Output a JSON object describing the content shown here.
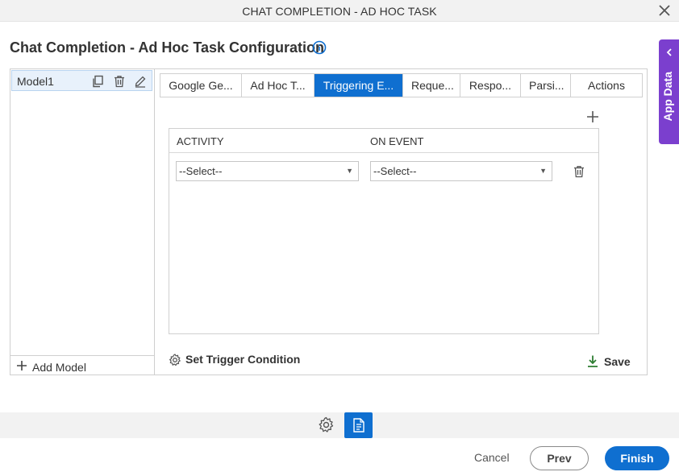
{
  "window": {
    "title": "CHAT COMPLETION - AD HOC TASK"
  },
  "page": {
    "title": "Chat Completion - Ad Hoc Task Configuration"
  },
  "side_panel": {
    "label": "App Data"
  },
  "models": {
    "items": [
      {
        "name": "Model1"
      }
    ],
    "add_label": "Add Model"
  },
  "tabs": [
    {
      "label": "Google Ge...",
      "active": false
    },
    {
      "label": "Ad Hoc T...",
      "active": false
    },
    {
      "label": "Triggering E...",
      "active": true
    },
    {
      "label": "Reque...",
      "active": false
    },
    {
      "label": "Respo...",
      "active": false
    },
    {
      "label": "Parsi...",
      "active": false
    },
    {
      "label": "Actions",
      "active": false
    }
  ],
  "grid": {
    "columns": [
      "ACTIVITY",
      "ON EVENT"
    ],
    "rows": [
      {
        "activity": "--Select--",
        "on_event": "--Select--"
      }
    ]
  },
  "actions": {
    "trigger_label": "Set Trigger Condition",
    "save_label": "Save"
  },
  "footer": {
    "cancel": "Cancel",
    "prev": "Prev",
    "finish": "Finish"
  },
  "colors": {
    "primary": "#0f6fd0",
    "app_data": "#7b3fce",
    "save_icon": "#2e7d32"
  },
  "icons": [
    "close-icon",
    "info-icon",
    "chevron-left-icon",
    "copy-icon",
    "trash-icon",
    "edit-icon",
    "plus-icon",
    "gear-icon",
    "download-icon",
    "document-icon"
  ]
}
